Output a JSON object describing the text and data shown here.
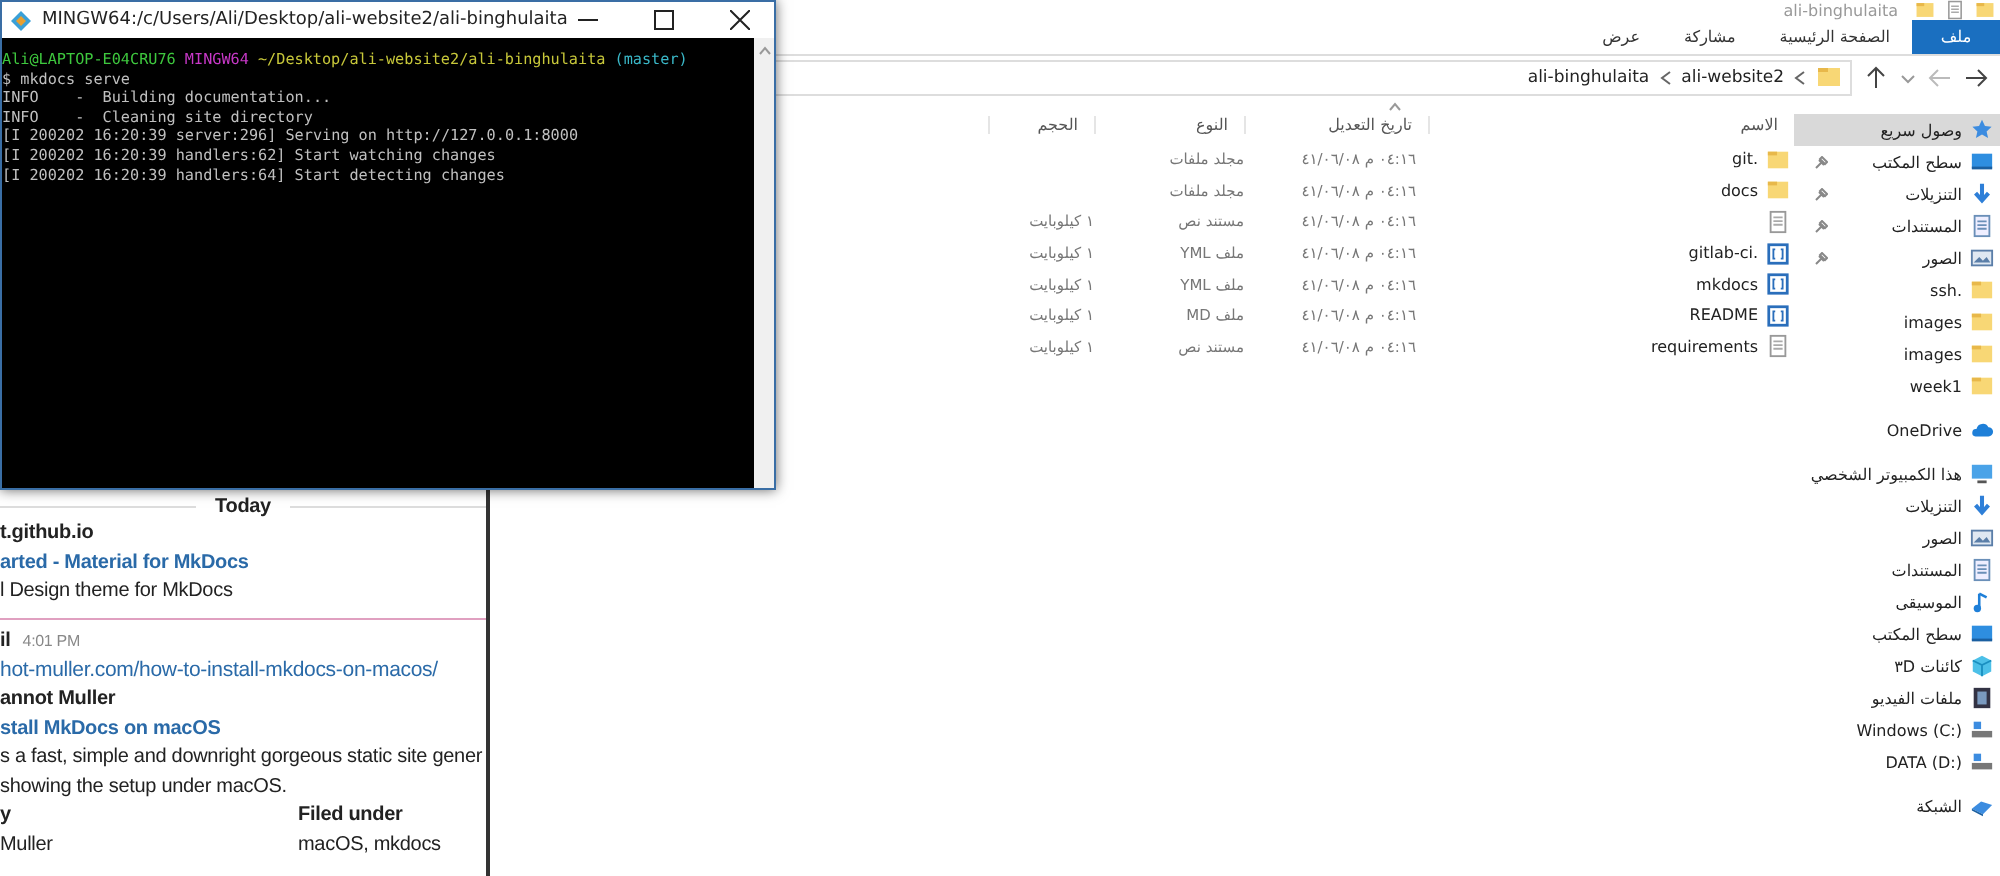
{
  "terminal": {
    "title": "MINGW64:/c/Users/Ali/Desktop/ali-website2/ali-binghulaita",
    "prompt": {
      "user": "Ali@LAPTOP-E04CRU76",
      "shell": "MINGW64",
      "path": "~/Desktop/ali-website2/ali-binghulaita",
      "branch": "(master)"
    },
    "lines": [
      "$ mkdocs serve",
      "INFO    -  Building documentation...",
      "INFO    -  Cleaning site directory",
      "[I 200202 16:20:39 server:296] Serving on http://127.0.0.1:8000",
      "[I 200202 16:20:39 handlers:62] Start watching changes",
      "[I 200202 16:20:39 handlers:64] Start detecting changes"
    ]
  },
  "chat": {
    "day_divider": "Today",
    "lines": [
      {
        "kind": "bold",
        "text": "t.github.io"
      },
      {
        "kind": "link",
        "text": "arted - Material for MkDocs"
      },
      {
        "kind": "text",
        "text": "l Design theme for MkDocs"
      },
      {
        "kind": "separator"
      },
      {
        "kind": "sender",
        "text": "il",
        "time": "4:01 PM"
      },
      {
        "kind": "url",
        "text": "hot-muller.com/how-to-install-mkdocs-on-macos/"
      },
      {
        "kind": "bold",
        "text": "annot Muller"
      },
      {
        "kind": "link",
        "text": "stall MkDocs on macOS"
      },
      {
        "kind": "text",
        "text": "s a fast, simple and downright gorgeous static site gener"
      },
      {
        "kind": "text",
        "text": "showing the setup under macOS."
      },
      {
        "kind": "pair_head",
        "text": "y",
        "right": "Filed under"
      },
      {
        "kind": "pair",
        "text": "Muller",
        "right": "macOS, mkdocs"
      }
    ]
  },
  "explorer": {
    "title": "ali-binghulaita",
    "ribbon_tabs": [
      {
        "label": "ملف",
        "selected": true
      },
      {
        "label": "الصفحة الرئيسية",
        "selected": false
      },
      {
        "label": "مشاركة",
        "selected": false
      },
      {
        "label": "عرض",
        "selected": false
      }
    ],
    "path": [
      "ali-website2",
      "ali-binghulaita"
    ],
    "columns": [
      "الاسم",
      "تاريخ التعديل",
      "النوع",
      "الحجم"
    ],
    "files": [
      {
        "name": ".git",
        "kind": "folder",
        "date": "٠٤:١٦ م ٤١/٠٦/٠٨",
        "type": "مجلد ملفات"
      },
      {
        "name": "docs",
        "kind": "folder",
        "date": "٠٤:١٦ م ٤١/٠٦/٠٨",
        "type": "مجلد ملفات"
      },
      {
        "kind": "text",
        "date": "٠٤:١٦ م ٤١/٠٦/٠٨",
        "type": "مستند نص",
        "size": "١ كيلوبايت"
      },
      {
        "name": ".gitlab-ci",
        "kind": "code",
        "date": "٠٤:١٦ م ٤١/٠٦/٠٨",
        "type": "ملف YML",
        "size": "١ كيلوبايت"
      },
      {
        "name": "mkdocs",
        "kind": "code",
        "date": "٠٤:١٦ م ٤١/٠٦/٠٨",
        "type": "ملف YML",
        "size": "١ كيلوبايت"
      },
      {
        "name": "README",
        "kind": "code",
        "date": "٠٤:١٦ م ٤١/٠٦/٠٨",
        "type": "ملف MD",
        "size": "١ كيلوبايت"
      },
      {
        "name": "requirements",
        "kind": "text",
        "date": "٠٤:١٦ م ٤١/٠٦/٠٨",
        "type": "مستند نص",
        "size": "١ كيلوبايت"
      }
    ],
    "nav": [
      {
        "label": "وصول سريع",
        "kind": "star",
        "selected": true,
        "children": [
          {
            "label": "سطح المكتب",
            "kind": "desktop",
            "pinned": true
          },
          {
            "label": "التنزيلات",
            "kind": "download",
            "pinned": true
          },
          {
            "label": "المستندات",
            "kind": "docs",
            "pinned": true
          },
          {
            "label": "الصور",
            "kind": "pictures",
            "pinned": true
          },
          {
            "label": ".ssh",
            "kind": "folder",
            "pinned": false
          },
          {
            "label": "images",
            "kind": "folder",
            "pinned": false
          },
          {
            "label": "images",
            "kind": "folder",
            "pinned": false
          },
          {
            "label": "week1",
            "kind": "folder",
            "pinned": false
          }
        ]
      },
      {
        "label": "OneDrive",
        "kind": "cloud",
        "selected": false
      },
      {
        "label": "هذا الكمبيوتر الشخصي",
        "kind": "pc",
        "selected": false,
        "children": [
          {
            "label": "التنزيلات",
            "kind": "download",
            "pinned": false
          },
          {
            "label": "الصور",
            "kind": "pictures",
            "pinned": false
          },
          {
            "label": "المستندات",
            "kind": "docs",
            "pinned": false
          },
          {
            "label": "الموسيقى",
            "kind": "music",
            "pinned": false
          },
          {
            "label": "سطح المكتب",
            "kind": "desktop",
            "pinned": false
          },
          {
            "label": "كائنات ٣D",
            "kind": "cube",
            "pinned": false
          },
          {
            "label": "ملفات الفيديو",
            "kind": "video",
            "pinned": false
          },
          {
            "label": "Windows (C:)",
            "kind": "drive",
            "pinned": false
          },
          {
            "label": "DATA (D:)",
            "kind": "drive",
            "pinned": false
          }
        ]
      },
      {
        "label": "الشبكة",
        "kind": "network",
        "selected": false
      }
    ]
  }
}
